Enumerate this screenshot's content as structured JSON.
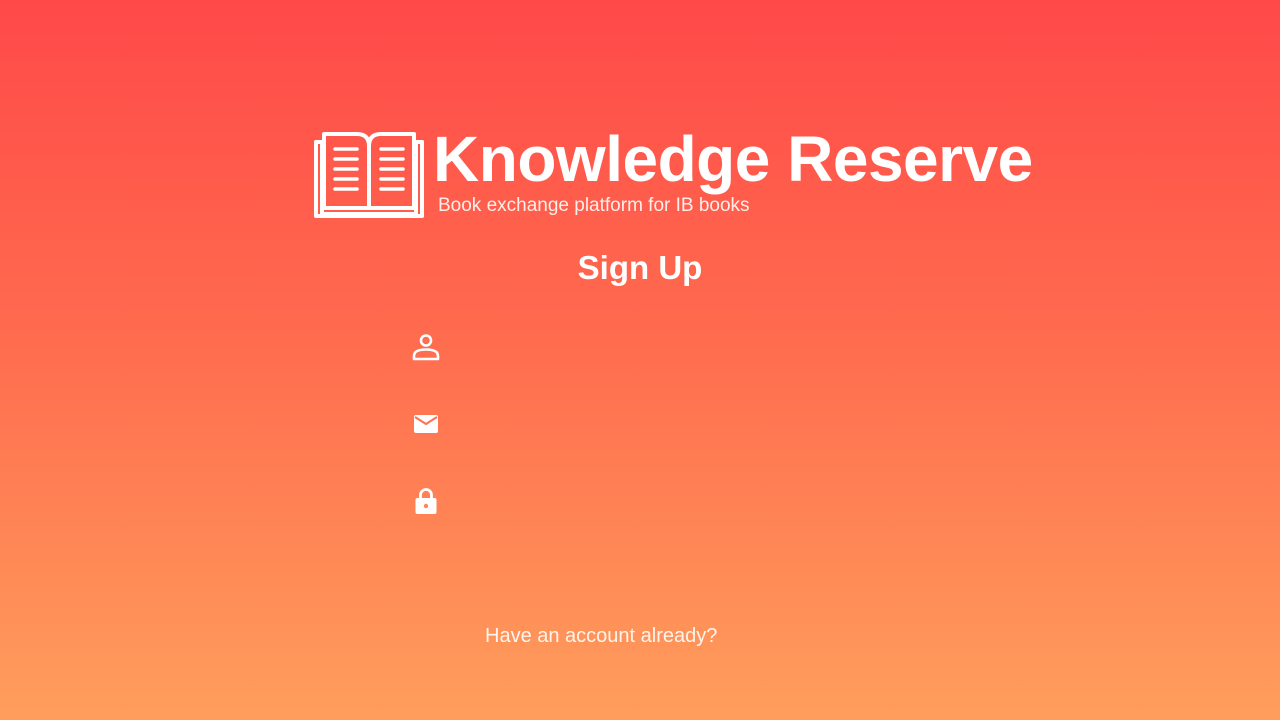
{
  "brand": {
    "title": "Knowledge Reserve",
    "tagline": "Book exchange platform for IB books",
    "logo_icon": "open-book-icon"
  },
  "form": {
    "title": "Sign Up",
    "fields": [
      {
        "icon": "person-icon",
        "value": "",
        "placeholder": ""
      },
      {
        "icon": "envelope-icon",
        "value": "",
        "placeholder": ""
      },
      {
        "icon": "lock-icon",
        "value": "",
        "placeholder": ""
      }
    ],
    "login_link": "Have an account already?"
  },
  "colors": {
    "gradient_top": "#ff4949",
    "gradient_bottom": "#ff9e5c",
    "foreground": "#ffffff"
  }
}
